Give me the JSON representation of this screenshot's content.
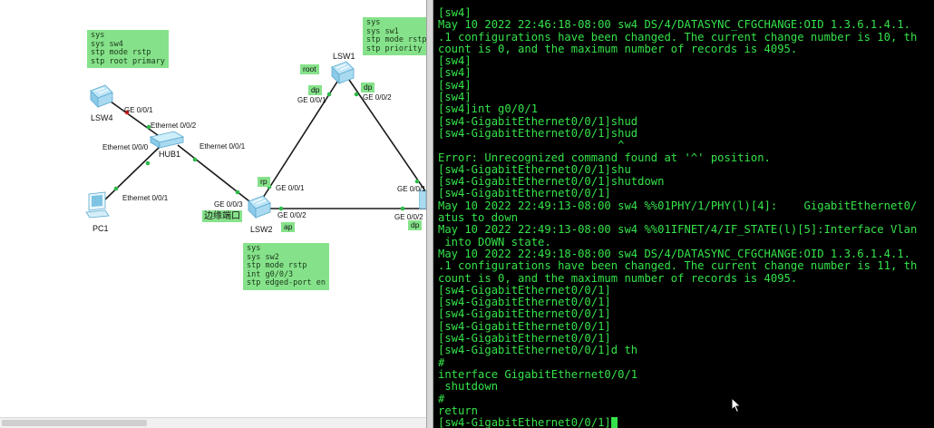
{
  "topology": {
    "devices": {
      "lsw1": "LSW1",
      "lsw2": "LSW2",
      "lsw4": "LSW4",
      "hub1": "HUB1",
      "pc1": "PC1"
    },
    "notes": {
      "sw4": "sys\nsys sw4\nstp mode rstp\nstp root primary",
      "sw1": "sys\nsys sw1\nstp mode rstp\nstp priority",
      "sw2": "sys\nsys sw2\nstp mode rstp\nint g0/0/3\nstp edged-port en"
    },
    "ports": {
      "lsw4_ge001": "GE 0/0/1",
      "hub_eth002": "Ethernet 0/0/2",
      "hub_eth000": "Ethernet 0/0/0",
      "hub_eth001": "Ethernet 0/0/1",
      "pc_eth001": "Ethernet 0/0/1",
      "lsw2_ge003": "GE 0/0/3",
      "lsw2_ge001": "GE 0/0/1",
      "lsw2_ge002": "GE 0/0/2",
      "lsw1_ge001": "GE 0/0/1",
      "lsw1_ge002": "GE 0/0/2",
      "right_ge001": "GE 0/0/1",
      "right_ge002": "GE 0/0/2"
    },
    "roles": {
      "root": "root",
      "dp1": "dp",
      "dp2": "dp",
      "rp": "rp",
      "ap": "ap",
      "dp_right": "dp"
    },
    "edge_port_label": "边缘端口",
    "colors": {
      "note_bg": "#86e28a",
      "link": "#1a1a1a",
      "port_up": "#2db84a",
      "port_down": "#e02020"
    }
  },
  "terminal": {
    "text_color": "#35e34a",
    "background": "#000000",
    "lines": [
      "[sw4]",
      "May 10 2022 22:46:18-08:00 sw4 DS/4/DATASYNC_CFGCHANGE:OID 1.3.6.1.4.1.",
      ".1 configurations have been changed. The current change number is 10, th",
      "count is 0, and the maximum number of records is 4095.",
      "[sw4]",
      "[sw4]",
      "[sw4]",
      "[sw4]",
      "[sw4]int g0/0/1",
      "[sw4-GigabitEthernet0/0/1]shud",
      "[sw4-GigabitEthernet0/0/1]shud",
      "                           ^",
      "Error: Unrecognized command found at '^' position.",
      "[sw4-GigabitEthernet0/0/1]shu",
      "[sw4-GigabitEthernet0/0/1]shutdown",
      "[sw4-GigabitEthernet0/0/1]",
      "May 10 2022 22:49:13-08:00 sw4 %%01PHY/1/PHY(l)[4]:    GigabitEthernet0/",
      "atus to down",
      "May 10 2022 22:49:13-08:00 sw4 %%01IFNET/4/IF_STATE(l)[5]:Interface Vlan",
      " into DOWN state.",
      "May 10 2022 22:49:18-08:00 sw4 DS/4/DATASYNC_CFGCHANGE:OID 1.3.6.1.4.1.",
      ".1 configurations have been changed. The current change number is 11, th",
      "count is 0, and the maximum number of records is 4095.",
      "[sw4-GigabitEthernet0/0/1]",
      "[sw4-GigabitEthernet0/0/1]",
      "[sw4-GigabitEthernet0/0/1]",
      "[sw4-GigabitEthernet0/0/1]",
      "[sw4-GigabitEthernet0/0/1]",
      "[sw4-GigabitEthernet0/0/1]d th",
      "#",
      "interface GigabitEthernet0/0/1",
      " shutdown",
      "#",
      "return"
    ],
    "prompt": "[sw4-GigabitEthernet0/0/1]"
  }
}
